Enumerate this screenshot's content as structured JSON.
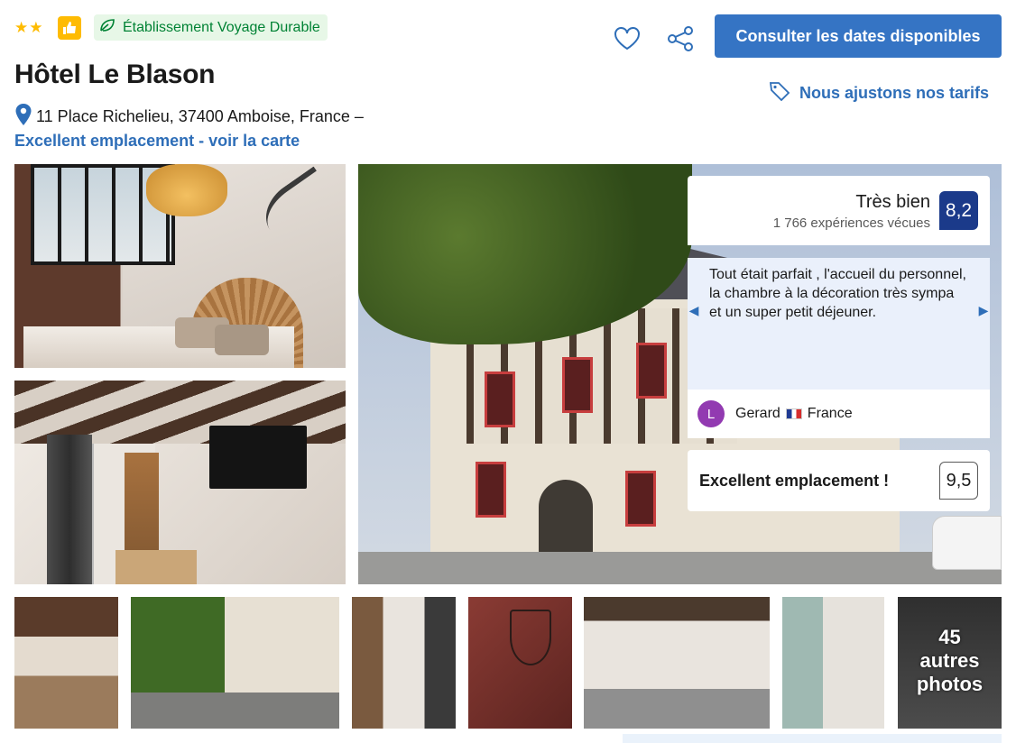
{
  "header": {
    "star_count": 2,
    "sustainability_label": "Établissement Voyage Durable",
    "hotel_name": "Hôtel Le Blason",
    "address": "11 Place Richelieu, 37400 Amboise, France –",
    "location_link": "Excellent emplacement - voir la carte",
    "cta_label": "Consulter les dates disponibles",
    "price_match_label": "Nous ajustons nos tarifs"
  },
  "review_panel": {
    "rating_word": "Très bien",
    "rating_count": "1 766 expériences vécues",
    "score": "8,2",
    "review_text": "Tout était parfait , l'accueil du personnel, la chambre à la décoration très sympa et un super petit déjeuner.",
    "reviewer_initial": "L",
    "reviewer_name": "Gerard",
    "reviewer_country": "France",
    "location_label": "Excellent emplacement !",
    "location_score": "9,5"
  },
  "gallery": {
    "more_count": "45",
    "more_label_1": "autres",
    "more_label_2": "photos"
  },
  "colors": {
    "brand_blue": "#3574c4",
    "score_navy": "#1b3a8a",
    "star_yellow": "#febb02",
    "sustainable_green": "#008234",
    "avatar_purple": "#923ab1"
  }
}
